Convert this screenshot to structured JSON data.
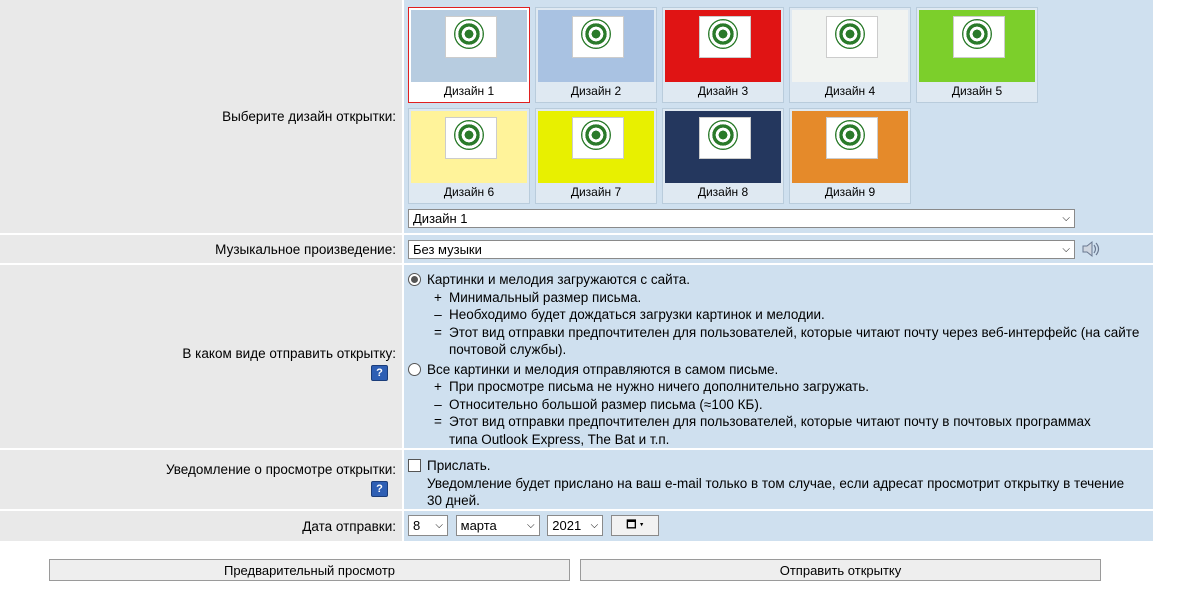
{
  "design": {
    "label": "Выберите дизайн открытки:",
    "thumbs": [
      {
        "name": "Дизайн 1",
        "bg": "#b7cce0"
      },
      {
        "name": "Дизайн 2",
        "bg": "#a9c2e2"
      },
      {
        "name": "Дизайн 3",
        "bg": "#e01414"
      },
      {
        "name": "Дизайн 4",
        "bg": "#f1f3f1"
      },
      {
        "name": "Дизайн 5",
        "bg": "#7ccf2b"
      },
      {
        "name": "Дизайн 6",
        "bg": "#fff39a"
      },
      {
        "name": "Дизайн 7",
        "bg": "#e8f000"
      },
      {
        "name": "Дизайн 8",
        "bg": "#24375e"
      },
      {
        "name": "Дизайн 9",
        "bg": "#e58a2a"
      }
    ],
    "selected": "Дизайн 1"
  },
  "music": {
    "label": "Музыкальное произведение:",
    "selected": "Без музыки",
    "icon": "speaker-icon"
  },
  "send_mode": {
    "label": "В каком виде отправить открытку:",
    "help": "?",
    "option1": {
      "title": "Картинки и мелодия загружаются с сайта.",
      "l1_sym": "+",
      "l1": "Минимальный размер письма.",
      "l2_sym": "–",
      "l2": "Необходимо будет дождаться загрузки картинок и мелодии.",
      "l3_sym": "=",
      "l3": "Этот вид отправки предпочтителен для пользователей, которые читают почту через веб-интерфейс (на сайте почтовой службы)."
    },
    "option2": {
      "title": "Все картинки и мелодия отправляются в самом письме.",
      "l1_sym": "+",
      "l1": "При просмотре письма не нужно ничего дополнительно загружать.",
      "l2_sym": "–",
      "l2": "Относительно большой размер письма (≈100 КБ).",
      "l3_sym": "=",
      "l3": "Этот вид отправки предпочтителен для пользователей, которые читают почту в почтовых программах типа Outlook Express, The Bat и т.п."
    }
  },
  "notify": {
    "label": "Уведомление о просмотре открытки:",
    "help": "?",
    "check_label": "Прислать.",
    "desc": "Уведомление будет прислано на ваш e-mail только в том случае, если адресат просмотрит открытку в течение 30 дней."
  },
  "date": {
    "label": "Дата отправки:",
    "day": "8",
    "month": "марта",
    "year": "2021",
    "cal_icon": "calendar-icon"
  },
  "buttons": {
    "preview": "Предварительный просмотр",
    "send": "Отправить открытку"
  }
}
